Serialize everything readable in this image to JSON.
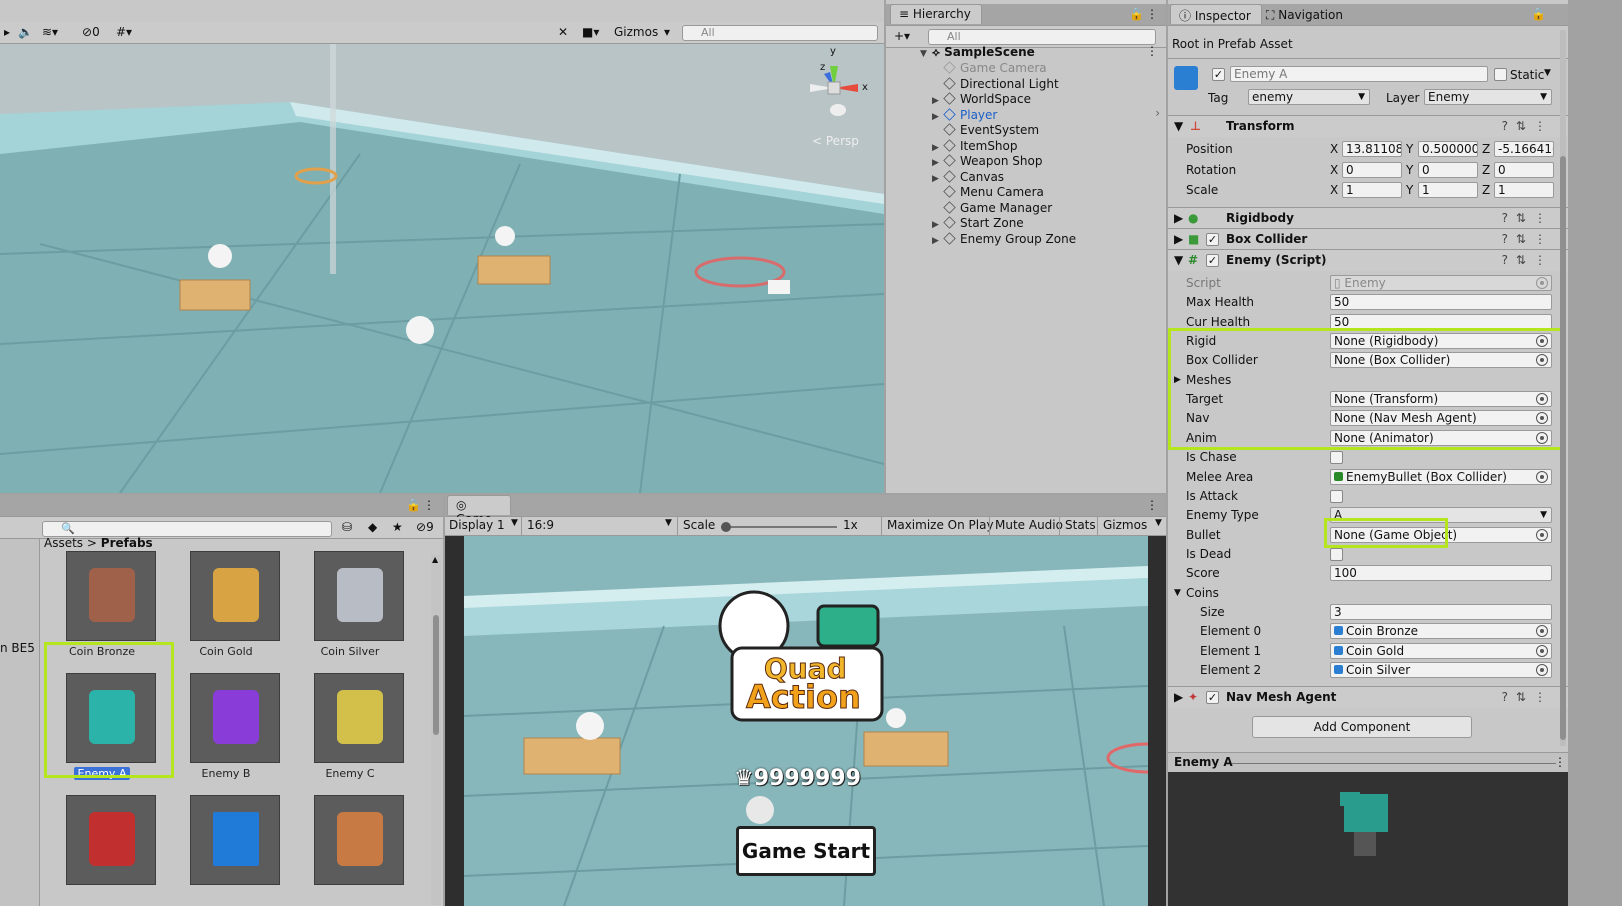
{
  "scene_toolbar": {
    "hidden_count": "0",
    "gizmos": "Gizmos",
    "search_placeholder": "All"
  },
  "scene_view": {
    "persp_label": "Persp",
    "axis_y": "y",
    "axis_z": "z",
    "axis_x": "x"
  },
  "hierarchy": {
    "tab": "Hierarchy",
    "search_placeholder": "All",
    "scene": "SampleScene",
    "items": [
      {
        "label": "Game Camera",
        "style": "disabled",
        "fold": ""
      },
      {
        "label": "Directional Light",
        "style": "normal",
        "fold": ""
      },
      {
        "label": "WorldSpace",
        "style": "normal",
        "fold": "▶"
      },
      {
        "label": "Player",
        "style": "prefab",
        "fold": "▶"
      },
      {
        "label": "EventSystem",
        "style": "normal",
        "fold": ""
      },
      {
        "label": "ItemShop",
        "style": "normal",
        "fold": "▶"
      },
      {
        "label": "Weapon Shop",
        "style": "normal",
        "fold": "▶"
      },
      {
        "label": "Canvas",
        "style": "normal",
        "fold": "▶"
      },
      {
        "label": "Menu Camera",
        "style": "normal",
        "fold": ""
      },
      {
        "label": "Game Manager",
        "style": "normal",
        "fold": ""
      },
      {
        "label": "Start Zone",
        "style": "normal",
        "fold": "▶"
      },
      {
        "label": "Enemy Group Zone",
        "style": "normal",
        "fold": "▶"
      }
    ]
  },
  "inspector": {
    "tab": "Inspector",
    "nav_tab": "Navigation",
    "root_label": "Root in Prefab Asset",
    "object_name": "Enemy A",
    "static_label": "Static",
    "tag_label": "Tag",
    "tag_value": "enemy",
    "layer_label": "Layer",
    "layer_value": "Enemy",
    "transform": {
      "title": "Transform",
      "position_label": "Position",
      "rotation_label": "Rotation",
      "scale_label": "Scale",
      "pos_x": "13.81108",
      "pos_y": "0.500000",
      "pos_z": "-5.166416",
      "rot_x": "0",
      "rot_y": "0",
      "rot_z": "0",
      "scl_x": "1",
      "scl_y": "1",
      "scl_z": "1",
      "x": "X",
      "y": "Y",
      "z": "Z"
    },
    "rigidbody": "Rigidbody",
    "box_collider": "Box Collider",
    "enemy_script": {
      "title": "Enemy (Script)",
      "script_label": "Script",
      "script_value": "Enemy",
      "max_health_label": "Max Health",
      "max_health": "50",
      "cur_health_label": "Cur Health",
      "cur_health": "50",
      "rigid_label": "Rigid",
      "rigid": "None (Rigidbody)",
      "boxcol_label": "Box Collider",
      "boxcol": "None (Box Collider)",
      "meshes_label": "Meshes",
      "target_label": "Target",
      "target": "None (Transform)",
      "nav_label": "Nav",
      "nav": "None (Nav Mesh Agent)",
      "anim_label": "Anim",
      "anim": "None (Animator)",
      "is_chase_label": "Is Chase",
      "melee_label": "Melee Area",
      "melee": "EnemyBullet (Box Collider)",
      "is_attack_label": "Is Attack",
      "enemy_type_label": "Enemy Type",
      "enemy_type": "A",
      "bullet_label": "Bullet",
      "bullet": "None (Game Object)",
      "is_dead_label": "Is Dead",
      "score_label": "Score",
      "score": "100",
      "coins_label": "Coins",
      "size_label": "Size",
      "size": "3",
      "el0_label": "Element 0",
      "el0": "Coin Bronze",
      "el1_label": "Element 1",
      "el1": "Coin Gold",
      "el2_label": "Element 2",
      "el2": "Coin Silver"
    },
    "nav_mesh_agent": "Nav Mesh Agent",
    "add_component": "Add Component",
    "preview_title": "Enemy A"
  },
  "project": {
    "breadcrumb_root": "Assets",
    "breadcrumb_sep": ">",
    "breadcrumb_leaf": "Prefabs",
    "hidden_count": "9",
    "left_item": "n BE5",
    "assets": [
      {
        "label": "Coin Bronze",
        "color": "#a0614a"
      },
      {
        "label": "Coin Gold",
        "color": "#d8a443"
      },
      {
        "label": "Coin Silver",
        "color": "#b8bcc4"
      },
      {
        "label": "Enemy A",
        "color": "#2bb3aa"
      },
      {
        "label": "Enemy B",
        "color": "#8a3cd8"
      },
      {
        "label": "Enemy C",
        "color": "#d2c04a"
      },
      {
        "label": "",
        "color": "#c22f2f"
      },
      {
        "label": "",
        "color": "#1f7ad8"
      },
      {
        "label": "",
        "color": "#c87a45"
      }
    ]
  },
  "game": {
    "tab": "Game",
    "display": "Display 1",
    "aspect": "16:9",
    "scale_label": "Scale",
    "scale_value": "1x",
    "maximize": "Maximize On Play",
    "mute": "Mute Audio",
    "stats": "Stats",
    "gizmos": "Gizmos",
    "logo_line1": "Quad",
    "logo_line2": "Action",
    "score": "9999999",
    "start_button": "Game Start"
  },
  "colors": {
    "highlight": "#b5e61d",
    "floor": "#86b4b8",
    "wall": "#9fcfd3",
    "selection": "#3a72d8"
  }
}
